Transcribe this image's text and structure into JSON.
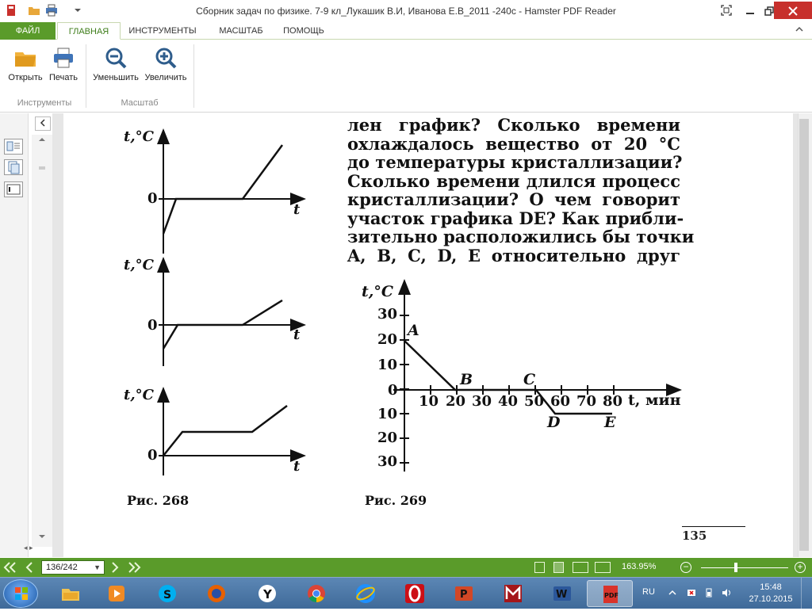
{
  "window": {
    "title": "Сборник задач по физике. 7-9 кл_Лукашик В.И, Иванова Е.В_2011 -240с - Hamster PDF Reader"
  },
  "ribbon": {
    "tabs": [
      {
        "label": "ФАЙЛ"
      },
      {
        "label": "ГЛАВНАЯ"
      },
      {
        "label": "ИНСТРУМЕНТЫ"
      },
      {
        "label": "МАСШТАБ"
      },
      {
        "label": "ПОМОЩЬ"
      }
    ],
    "buttons": {
      "open": "Открыть",
      "print": "Печать",
      "zoom_out": "Уменьшить",
      "zoom_in": "Увеличить"
    },
    "groups": {
      "tools": "Инструменты",
      "scale": "Масштаб"
    }
  },
  "document": {
    "paragraph_lines": [
      "лен график? Сколько времени",
      "охлаждалось вещество от 20 °С",
      "до температуры кристаллизации?",
      "Сколько времени длился процесс",
      "кристаллизации? О чем говорит",
      "участок графика DE? Как прибли-",
      "зительно расположились бы точки",
      "A, B, C, D, E относительно друг"
    ],
    "fig268_caption": "Рис. 268",
    "fig269_caption": "Рис. 269",
    "page_number": "135",
    "small_graphs": {
      "ylabel": "t,°C",
      "xlabel": "t",
      "zero": "0"
    },
    "graph269": {
      "ylabel": "t,°C",
      "xlabel": "t, мин",
      "y_ticks": [
        "30",
        "20",
        "10",
        "0",
        "10",
        "20",
        "30"
      ],
      "x_ticks": [
        "10",
        "20",
        "30",
        "40",
        "50",
        "60",
        "70",
        "80"
      ],
      "points": [
        "A",
        "B",
        "C",
        "D",
        "E"
      ]
    }
  },
  "status": {
    "page_box": "136/242",
    "zoom": "163.95%"
  },
  "taskbar": {
    "lang": "RU",
    "time": "15:48",
    "date": "27.10.2015"
  }
}
